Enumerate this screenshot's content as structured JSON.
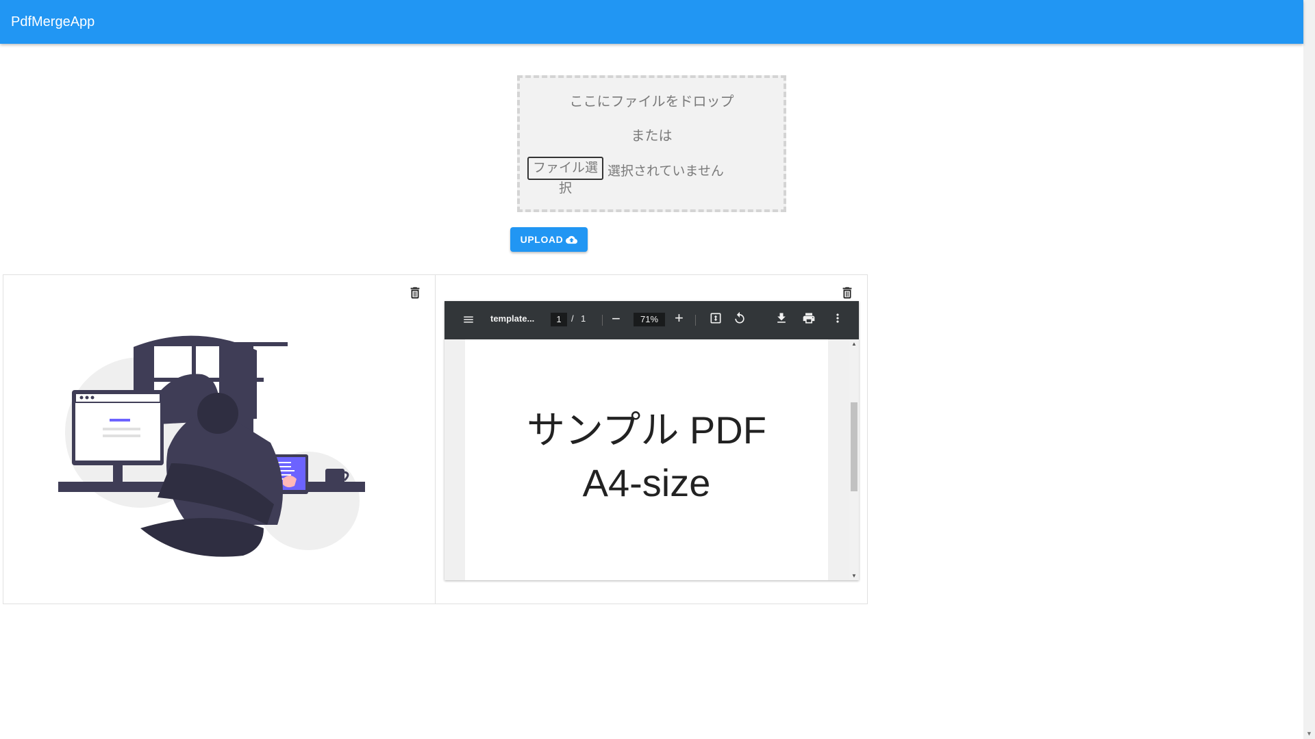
{
  "appbar": {
    "title": "PdfMergeApp",
    "color": "#2196f3"
  },
  "dropzone": {
    "drop_text": "ここにファイルをドロップ",
    "or_text": "または",
    "file_button": "ファイル選択",
    "no_file_text": "選択されていません"
  },
  "upload": {
    "label": "UPLOAD",
    "icon": "cloud-upload-icon"
  },
  "cards": [
    {
      "type": "image",
      "delete_icon": "trash-icon"
    },
    {
      "type": "pdf",
      "delete_icon": "trash-icon",
      "viewer": {
        "title": "template...",
        "page_current": "1",
        "page_separator": "/",
        "page_total": "1",
        "zoom": "71%",
        "minus": "−",
        "plus": "+",
        "page_text_line1": "サンプル PDF",
        "page_text_line2": "A4-size"
      }
    }
  ]
}
